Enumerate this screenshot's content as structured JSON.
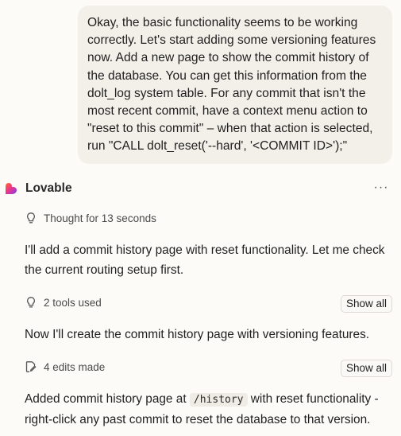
{
  "user_message": {
    "text": "Okay, the basic functionality seems to be working correctly. Let's start adding some versioning features now. Add a new page to show the commit history of the database. You can get this information from the dolt_log system table. For any commit that isn't the most recent commit, have a context menu action to \"reset to this commit\" – when that action is selected, run \"CALL dolt_reset('--hard', '<COMMIT ID>');\""
  },
  "assistant": {
    "name": "Lovable",
    "more_icon": "ellipsis-icon",
    "thought_label": "Thought for 13 seconds",
    "para1": "I'll add a commit history page with reset functionality. Let me check the current routing setup first.",
    "tools_label": "2 tools used",
    "tools_button": "Show all",
    "para2": "Now I'll create the commit history page with versioning features.",
    "edits_label": "4 edits made",
    "edits_button": "Show all",
    "final_prefix": "Added commit history page at",
    "final_code": "/history",
    "final_suffix": "with reset functionality - right-click any past commit to reset the database to that version."
  },
  "colors": {
    "background": "#fcfbf8",
    "user_bubble": "#f3f0ea",
    "logo_gradient": [
      "#ff5a36",
      "#e8358f",
      "#7b3ff2"
    ]
  }
}
